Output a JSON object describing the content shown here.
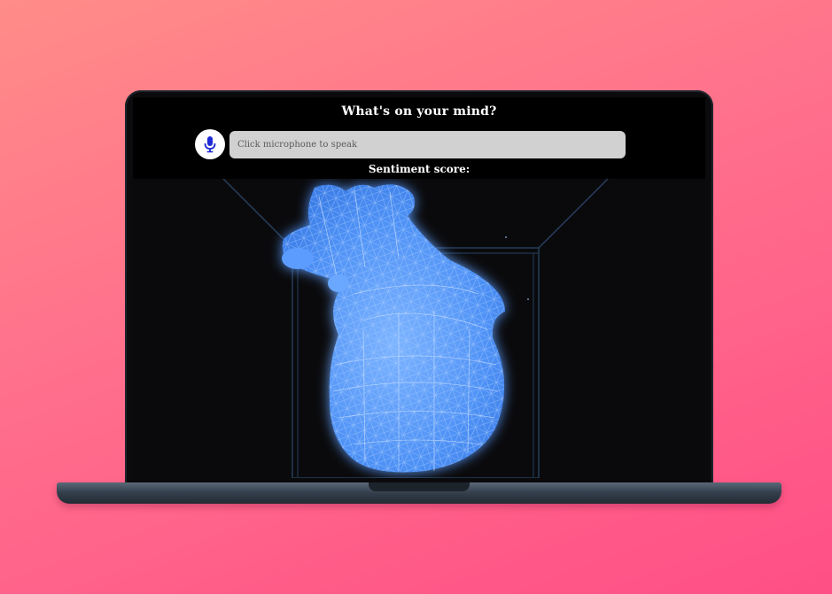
{
  "app": {
    "title": "What's on your mind?",
    "input_placeholder": "Click microphone to speak",
    "sentiment_label": "Sentiment score:"
  },
  "icons": {
    "mic": "microphone-icon",
    "visual": "wireframe-heart"
  },
  "colors": {
    "background_top": "#ff8c88",
    "background_bottom": "#ff4f86",
    "mic_icon": "#1f2bd6",
    "heart_glow": "#5aa0ff",
    "input_bg": "#d1d1d1"
  }
}
